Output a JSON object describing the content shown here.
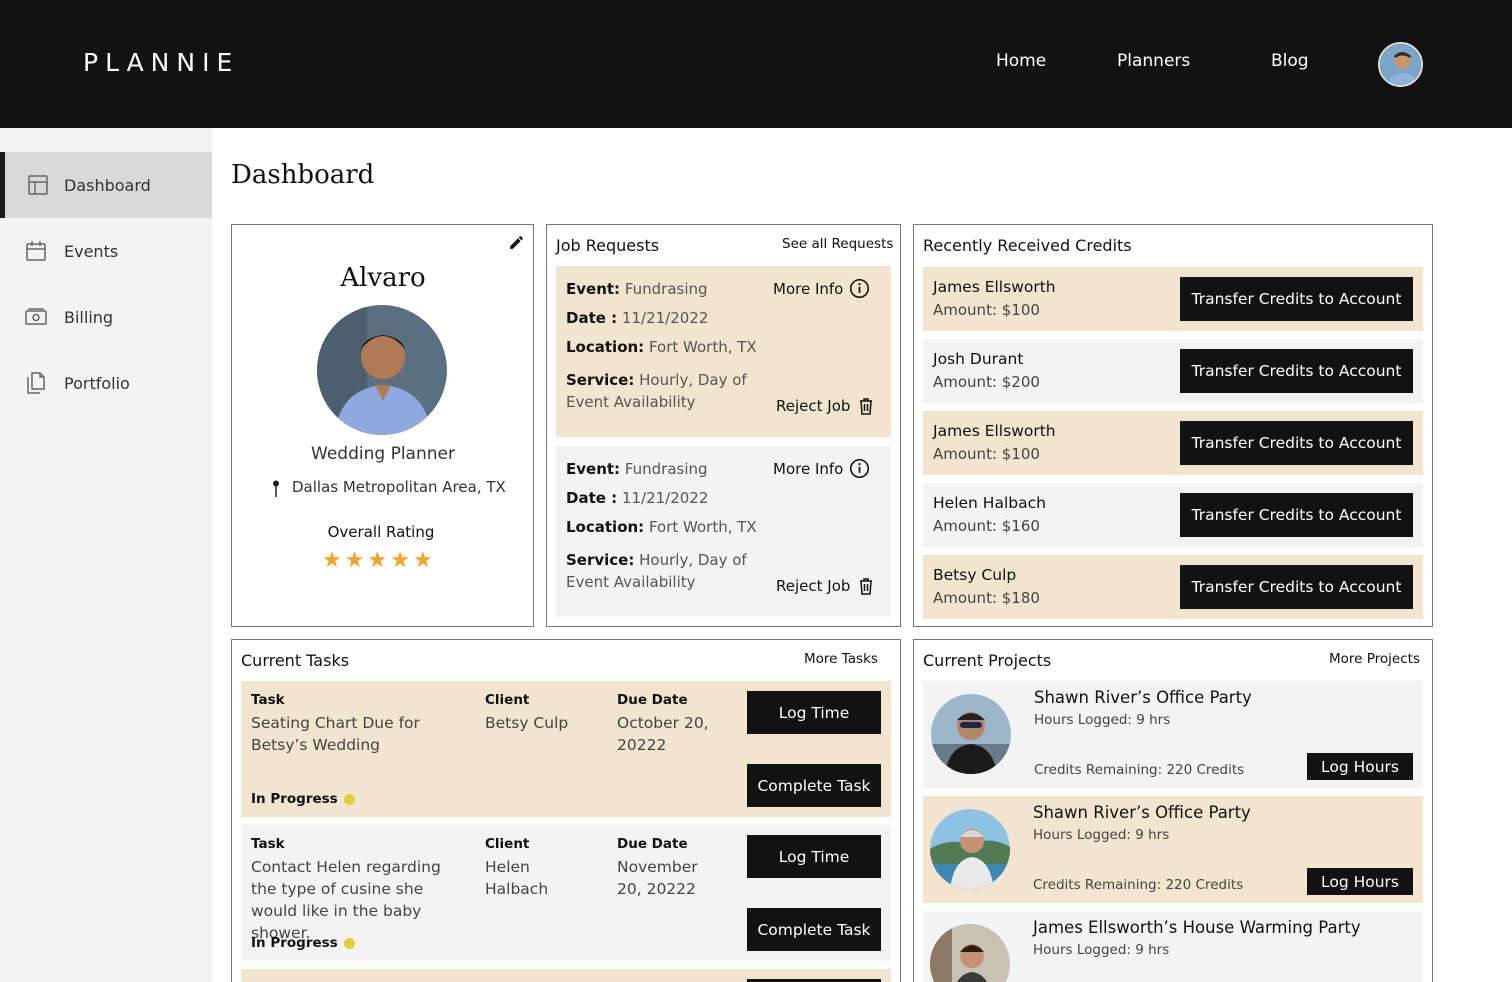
{
  "header": {
    "logo": "PLANNIE",
    "nav": [
      "Home",
      "Planners",
      "Blog"
    ],
    "avatar_icon": "user-avatar"
  },
  "sidebar": {
    "items": [
      {
        "label": "Dashboard",
        "icon": "layout-icon",
        "active": true
      },
      {
        "label": "Events",
        "icon": "calendar-icon",
        "active": false
      },
      {
        "label": "Billing",
        "icon": "cash-icon",
        "active": false
      },
      {
        "label": "Portfolio",
        "icon": "documents-icon",
        "active": false
      }
    ]
  },
  "page_title": "Dashboard",
  "profile": {
    "name": "Alvaro",
    "role": "Wedding Planner",
    "location": "Dallas Metropolitan Area, TX",
    "rating_label": "Overall Rating",
    "rating": 5,
    "rating_max": 5
  },
  "job_requests": {
    "title": "Job Requests",
    "see_all": "See all Requests",
    "labels": {
      "event": "Event:",
      "date": "Date :",
      "location": "Location:",
      "service": "Service:",
      "more_info": "More Info",
      "reject": "Reject Job"
    },
    "items": [
      {
        "event": "Fundrasing",
        "date": "11/21/2022",
        "location": "Fort Worth, TX",
        "service": "Hourly, Day of Event Availability"
      },
      {
        "event": "Fundrasing",
        "date": "11/21/2022",
        "location": "Fort Worth, TX",
        "service": "Hourly, Day of Event Availability"
      }
    ]
  },
  "credits": {
    "title": "Recently Received Credits",
    "button_label": "Transfer Credits to Account",
    "items": [
      {
        "name": "James Ellsworth",
        "amount": "Amount: $100"
      },
      {
        "name": "Josh Durant",
        "amount": "Amount: $200"
      },
      {
        "name": "James Ellsworth",
        "amount": "Amount: $100"
      },
      {
        "name": "Helen Halbach",
        "amount": "Amount: $160"
      },
      {
        "name": "Betsy Culp",
        "amount": "Amount: $180"
      }
    ]
  },
  "tasks": {
    "title": "Current Tasks",
    "more": "More Tasks",
    "headers": {
      "task": "Task",
      "client": "Client",
      "due": "Due Date"
    },
    "log_label": "Log Time",
    "complete_label": "Complete Task",
    "items": [
      {
        "task": "Seating Chart Due for Betsy’s Wedding",
        "client": "Betsy Culp",
        "due": "October 20, 20222",
        "status": "In Progress"
      },
      {
        "task": "Contact Helen regarding the type of cusine she would like in the baby shower.",
        "client": "Helen Halbach",
        "due": "November 20, 20222",
        "status": "In Progress"
      }
    ]
  },
  "projects": {
    "title": "Current Projects",
    "more": "More Projects",
    "button_label": "Log Hours",
    "items": [
      {
        "title": "Shawn River’s Office Party",
        "hours": "Hours Logged: 9 hrs",
        "credits": "Credits Remaining: 220 Credits"
      },
      {
        "title": "Shawn River’s Office Party",
        "hours": "Hours Logged: 9 hrs",
        "credits": "Credits Remaining: 220 Credits"
      },
      {
        "title": "James Ellsworth’s House Warming Party",
        "hours": "Hours Logged: 9 hrs",
        "credits": ""
      }
    ]
  },
  "colors": {
    "header_bg": "#121212",
    "beige": "#f1e5cf",
    "gray": "#f3f3f3",
    "star": "#f3a52b",
    "status_dot": "#e1cf3e"
  }
}
